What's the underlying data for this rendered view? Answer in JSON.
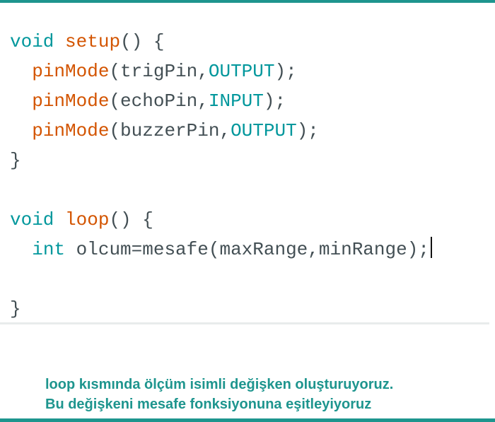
{
  "code": {
    "line1": {
      "kw": "void",
      "fn": "setup",
      "rest": "() {"
    },
    "line2": {
      "fn": "pinMode",
      "open": "(trigPin,",
      "const": "OUTPUT",
      "close": ");"
    },
    "line3": {
      "fn": "pinMode",
      "open": "(echoPin,",
      "const": "INPUT",
      "close": ");"
    },
    "line4": {
      "fn": "pinMode",
      "open": "(buzzerPin,",
      "const": "OUTPUT",
      "close": ");"
    },
    "line5": {
      "text": "}"
    },
    "line7": {
      "kw": "void",
      "fn": "loop",
      "rest": "() {"
    },
    "line8": {
      "kw": "int",
      "rest": " olcum=mesafe(maxRange,minRange);"
    },
    "line10": {
      "text": "}"
    }
  },
  "caption": {
    "line1": "loop kısmında ölçüm isimli değişken oluşturuyoruz.",
    "line2": "Bu değişkeni mesafe fonksiyonuna eşitleyiyoruz"
  },
  "colors": {
    "accent": "#1e958e",
    "keyword": "#00979c",
    "function": "#d35400",
    "text": "#434f54"
  }
}
